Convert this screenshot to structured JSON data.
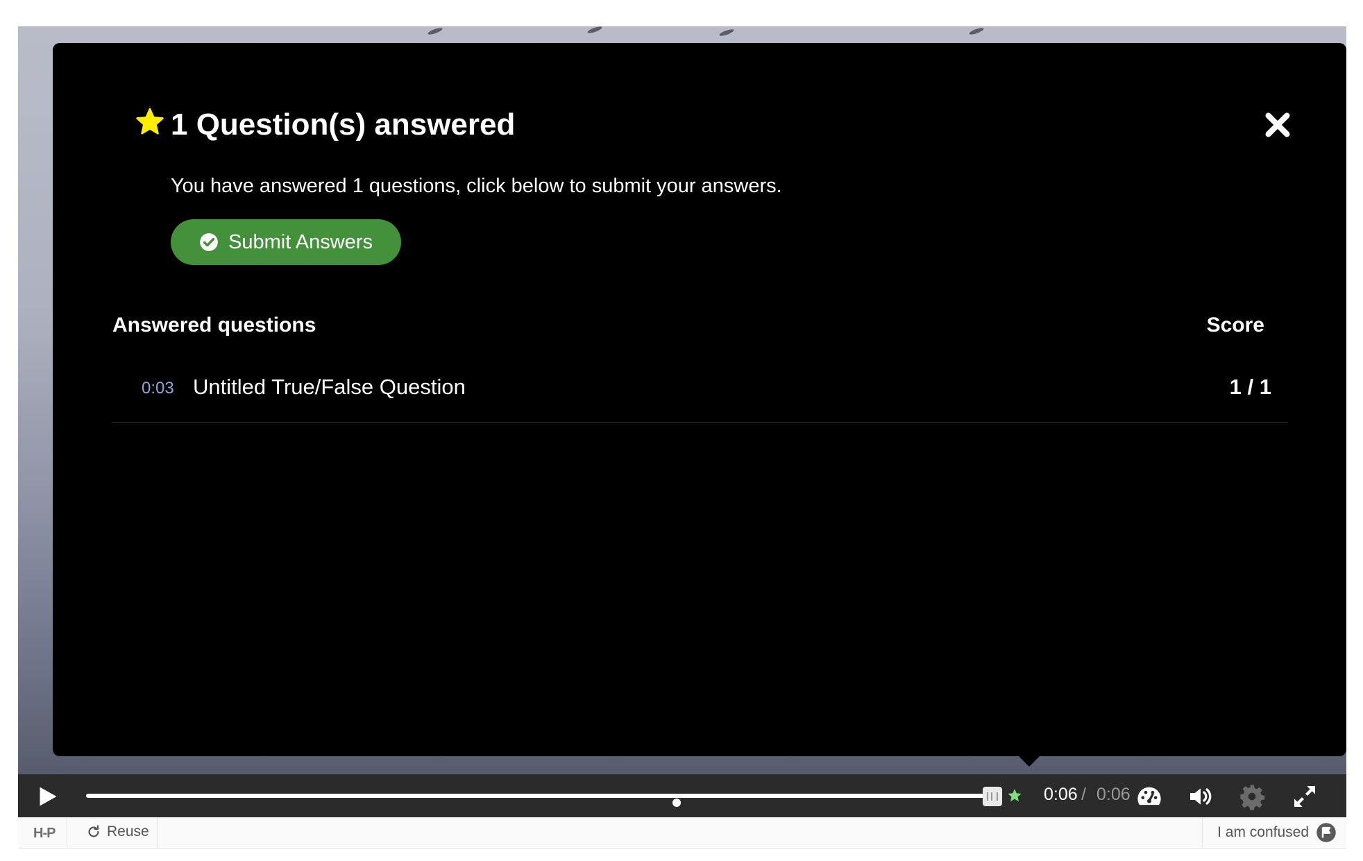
{
  "popup": {
    "title": "1 Question(s) answered",
    "description": "You have answered 1 questions, click below to submit your answers.",
    "submit_label": "Submit Answers",
    "table": {
      "col_question": "Answered questions",
      "col_score": "Score",
      "rows": [
        {
          "time": "0:03",
          "question": "Untitled True/False Question",
          "score": "1 / 1"
        }
      ]
    }
  },
  "controls": {
    "current_time": "0:06",
    "separator": "/",
    "duration": "0:06",
    "progress": 1.0
  },
  "footer": {
    "logo": "H-P",
    "reuse_label": "Reuse",
    "confused_label": "I am confused"
  },
  "colors": {
    "submit_button": "#43913a",
    "star": "#ffee00",
    "timestamp_link": "#8aa8d8",
    "controls_bg": "#2b2b2b",
    "end_star": "#7de07a"
  },
  "icons": {
    "star": "star-icon",
    "close": "close-icon",
    "submit": "check-circle-icon",
    "play": "play-icon",
    "speed": "speedometer-icon",
    "volume": "volume-icon",
    "settings": "gear-icon",
    "fullscreen": "fullscreen-icon",
    "reuse": "refresh-icon",
    "confused": "flag-icon"
  }
}
